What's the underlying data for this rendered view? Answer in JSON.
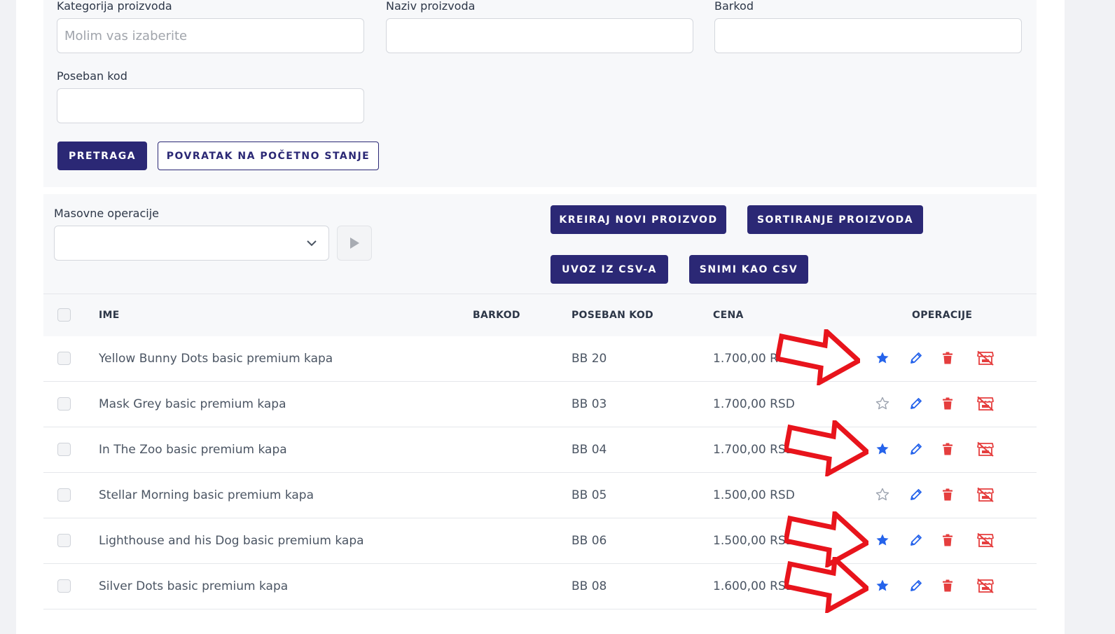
{
  "filters": {
    "category_label": "Kategorija proizvoda",
    "category_placeholder": "Molim vas izaberite",
    "name_label": "Naziv proizvoda",
    "name_value": "",
    "barcode_label": "Barkod",
    "barcode_value": "",
    "special_code_label": "Poseban kod",
    "special_code_value": "",
    "search_button": "PRETRAGA",
    "reset_button": "POVRATAK NA POČETNO STANJE"
  },
  "bulk": {
    "label": "Masovne operacije",
    "selected": "",
    "icons": {
      "dropdown": "chevron-down-icon",
      "run": "play-icon"
    }
  },
  "actions": {
    "create": "KREIRAJ NOVI PROIZVOD",
    "sort": "SORTIRANJE PROIZVODA",
    "import": "UVOZ IZ CSV-A",
    "export": "SNIMI KAO CSV"
  },
  "table": {
    "headers": {
      "name": "IME",
      "barcode": "BARKOD",
      "special_code": "POSEBAN KOD",
      "price": "CENA",
      "operations": "OPERACIJE"
    },
    "rows": [
      {
        "name": "Yellow Bunny Dots basic premium kapa",
        "barcode": "",
        "code": "BB 20",
        "price": "1.700,00 RSD",
        "featured": true,
        "highlighted": true
      },
      {
        "name": "Mask Grey basic premium kapa",
        "barcode": "",
        "code": "BB 03",
        "price": "1.700,00 RSD",
        "featured": false,
        "highlighted": false
      },
      {
        "name": "In The Zoo basic premium kapa",
        "barcode": "",
        "code": "BB 04",
        "price": "1.700,00 RSD",
        "featured": true,
        "highlighted": true
      },
      {
        "name": "Stellar Morning basic premium kapa",
        "barcode": "",
        "code": "BB 05",
        "price": "1.500,00 RSD",
        "featured": false,
        "highlighted": false
      },
      {
        "name": "Lighthouse and his Dog basic premium kapa",
        "barcode": "",
        "code": "BB 06",
        "price": "1.500,00 RSD",
        "featured": true,
        "highlighted": true
      },
      {
        "name": "Silver Dots basic premium kapa",
        "barcode": "",
        "code": "BB 08",
        "price": "1.600,00 RSD",
        "featured": true,
        "highlighted": true
      }
    ],
    "row_icons": [
      "star-icon",
      "pencil-icon",
      "trash-icon",
      "store-off-icon"
    ]
  },
  "colors": {
    "primary": "#2b2875",
    "star_active": "#2563eb",
    "danger": "#e53e3e",
    "annotation_arrow": "#e8141c"
  }
}
